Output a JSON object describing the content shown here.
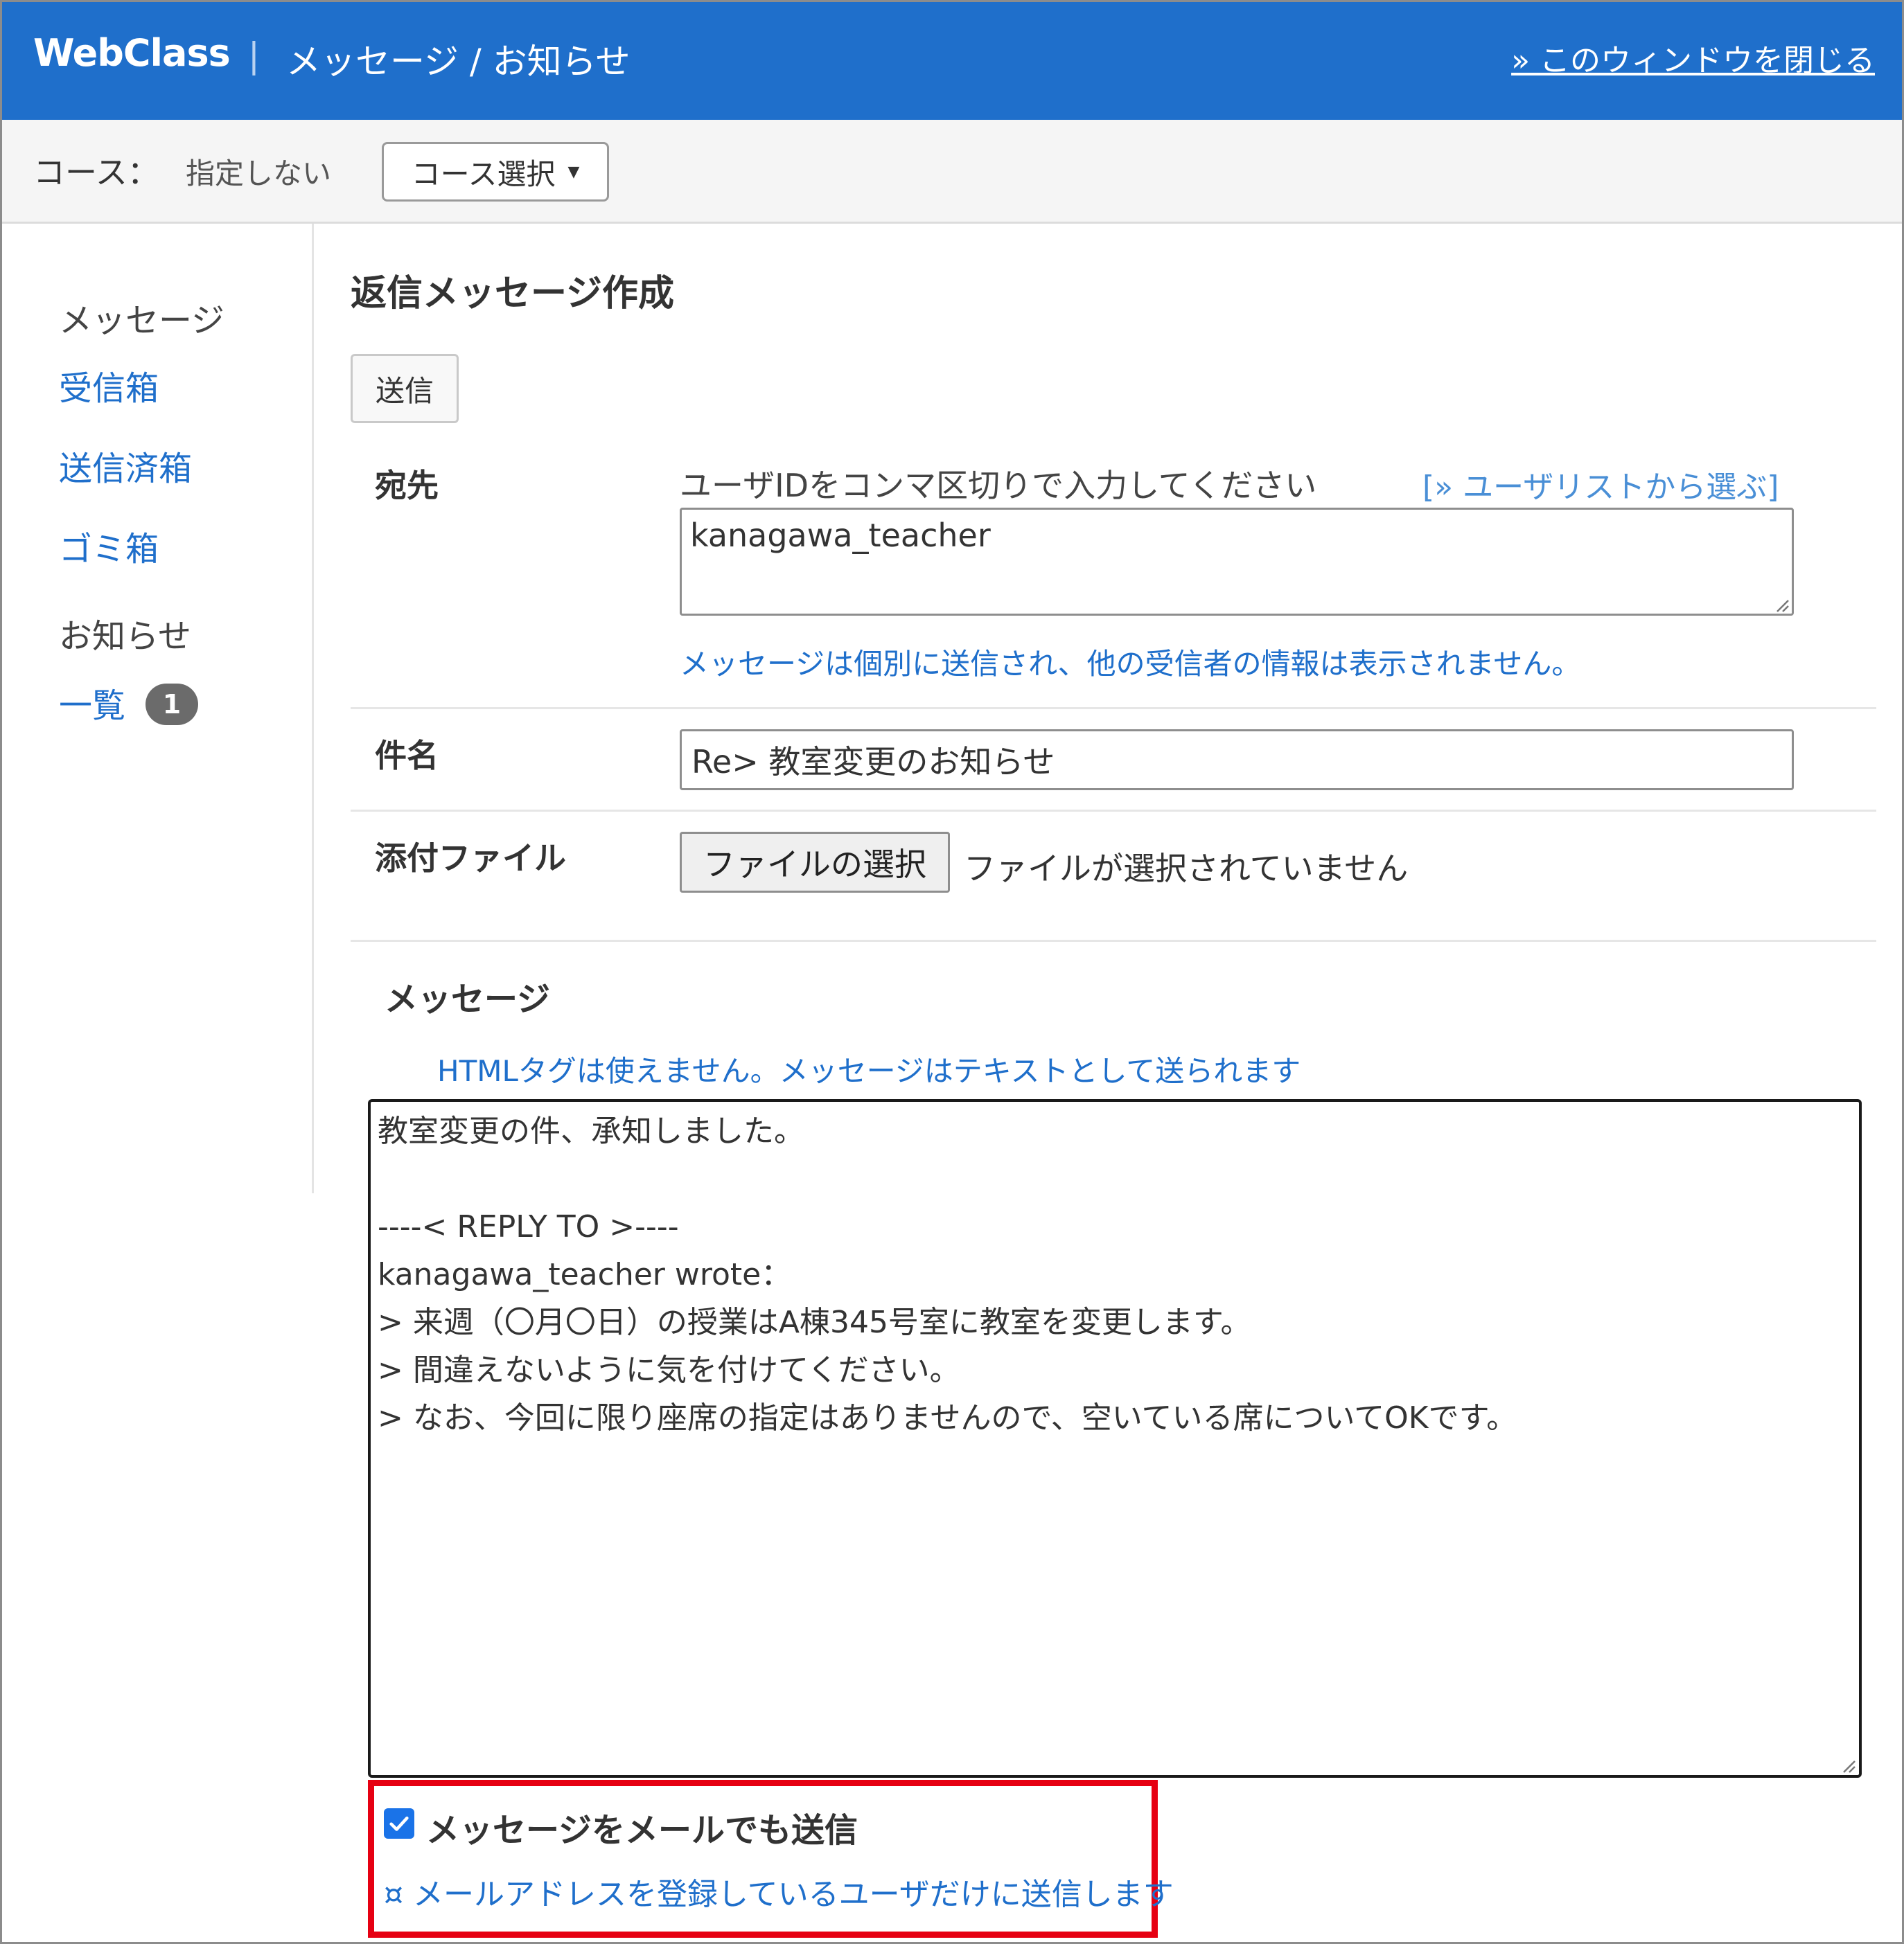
{
  "header": {
    "brand": "WebClass",
    "separator": "|",
    "title": "メッセージ / お知らせ",
    "close_link": "» このウィンドウを閉じる",
    "bg_color": "#1f6fcb"
  },
  "course": {
    "label": "コース：",
    "value": "指定しない",
    "select_button": "コース選択"
  },
  "sidebar": {
    "message_heading": "メッセージ",
    "inbox": "受信箱",
    "sent": "送信済箱",
    "trash": "ゴミ箱",
    "notice_heading": "お知らせ",
    "list": "一覧",
    "list_badge": "1"
  },
  "main": {
    "title": "返信メッセージ作成",
    "send_button": "送信",
    "to_label": "宛先",
    "to_hint": "ユーザIDをコンマ区切りで入力してください",
    "to_userlist_link": "[» ユーザリストから選ぶ]",
    "to_value": "kanagawa_teacher",
    "to_note": "メッセージは個別に送信され、他の受信者の情報は表示されません。",
    "subject_label": "件名",
    "subject_value": "Re> 教室変更のお知らせ",
    "attach_label": "添付ファイル",
    "file_button": "ファイルの選択",
    "file_status": "ファイルが選択されていません",
    "message_heading": "メッセージ",
    "message_hint": "HTMLタグは使えません。メッセージはテキストとして送られます",
    "message_body": "教室変更の件、承知しました。\n\n----< REPLY TO >----\nkanagawa_teacher wrote：\n> 来週（〇月〇日）の授業はA棟345号室に教室を変更します。\n> 間違えないように気を付けてください。\n> なお、今回に限り座席の指定はありませんので、空いている席についてOKです。",
    "email_checkbox_label": "メッセージをメールでも送信",
    "email_checkbox_checked": true,
    "email_note": "¤ メールアドレスを登録しているユーザだけに送信します",
    "highlight_color": "#e60012"
  }
}
